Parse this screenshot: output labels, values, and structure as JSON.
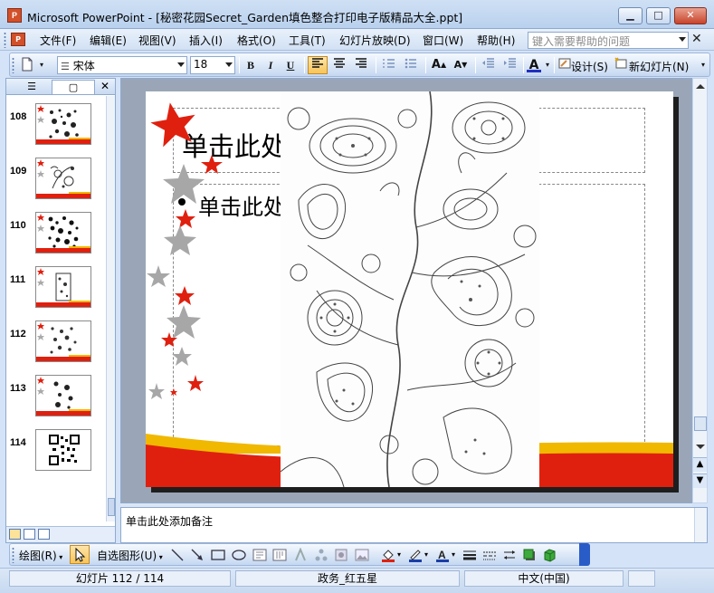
{
  "window": {
    "title": "Microsoft PowerPoint - [秘密花园Secret_Garden填色整合打印电子版精品大全.ppt]",
    "app_icon_text": "P",
    "minimize": "▁",
    "maximize": "□",
    "close": "✕"
  },
  "menu": {
    "items": [
      "文件(F)",
      "编辑(E)",
      "视图(V)",
      "插入(I)",
      "格式(O)",
      "工具(T)",
      "幻灯片放映(D)",
      "窗口(W)",
      "帮助(H)"
    ],
    "help_placeholder": "键入需要帮助的问题",
    "close": "✕"
  },
  "toolbar": {
    "font_name": "宋体",
    "font_size": "18",
    "bold": "B",
    "italic": "I",
    "underline": "U",
    "font_color_letter": "A",
    "design_label": "设计(S)",
    "new_slide_label": "新幻灯片(N)"
  },
  "left_pane": {
    "tab_outline": "☰",
    "tab_slides": "▢",
    "close": "✕",
    "thumbnails": [
      {
        "number": "108"
      },
      {
        "number": "109"
      },
      {
        "number": "110"
      },
      {
        "number": "111"
      },
      {
        "number": "112"
      },
      {
        "number": "113"
      },
      {
        "number": "114"
      }
    ]
  },
  "slide": {
    "title_placeholder": "单击此处",
    "body_placeholder": "单击此处"
  },
  "notes": {
    "placeholder": "单击此处添加备注"
  },
  "draw_toolbar": {
    "draw_label": "绘图(R)",
    "autoshapes_label": "自选图形(U)"
  },
  "status": {
    "slide_position": "幻灯片 112 / 114",
    "design_template": "政务_红五星",
    "language": "中文(中国)"
  },
  "colors": {
    "accent_red": "#e0200f",
    "accent_yellow": "#f1b800",
    "star_gray": "#a7a7a7"
  }
}
